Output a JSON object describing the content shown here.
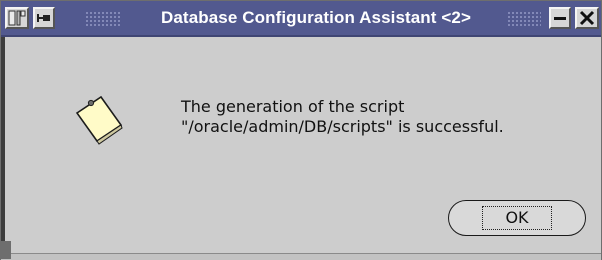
{
  "window": {
    "title": "Database Configuration Assistant <2>"
  },
  "titlebar_buttons": {
    "menu_icon": "window-menu-icon",
    "pin_icon": "pin-icon",
    "minimize_icon": "minimize-icon",
    "close_icon": "close-icon"
  },
  "dialog": {
    "icon": "note-icon",
    "message_line1": "The generation of the script",
    "message_line2": "\"/oracle/admin/DB/scripts\" is successful.",
    "ok_label": "OK"
  },
  "colors": {
    "titlebar": "#52598f",
    "background": "#cdcdcd",
    "note_fill": "#fffbc8"
  }
}
